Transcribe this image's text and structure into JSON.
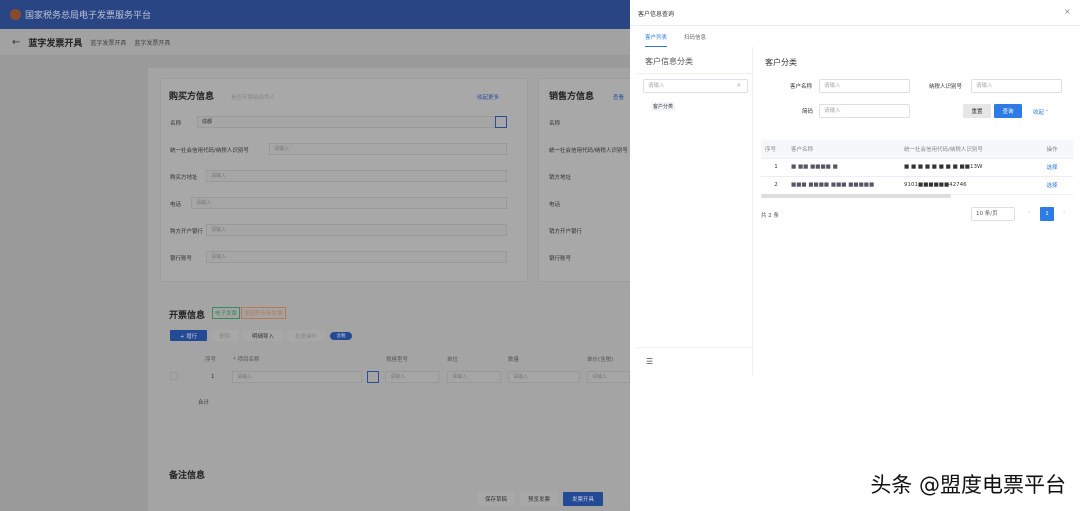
{
  "header": {
    "title": "国家税务总局电子发票服务平台"
  },
  "breadcrumb": {
    "page_title": "蓝字发票开具",
    "crumbs": [
      "蓝字发票开具",
      "蓝字发票开具"
    ]
  },
  "buyer": {
    "title": "购买方信息",
    "natural_person": "是否开票给自然人",
    "collapse": "收起更多",
    "fields": [
      {
        "label": "名称",
        "value": "成都"
      },
      {
        "label": "统一社会信用代码/纳税人识别号",
        "value": "请输入"
      },
      {
        "label": "购买方地址",
        "value": "请输入"
      },
      {
        "label": "电话",
        "value": "请输入"
      },
      {
        "label": "购方开户银行",
        "value": "请输入"
      },
      {
        "label": "银行账号",
        "value": "请输入"
      }
    ]
  },
  "seller": {
    "title": "销售方信息",
    "more": "查看",
    "fields": [
      "名称",
      "统一社会信用代码/纳税人识别号",
      "销方地址",
      "电话",
      "销方开户银行",
      "银行账号"
    ]
  },
  "invoice": {
    "title": "开票信息",
    "tag_green": "电子发票",
    "tag_orange": "增值税专用发票",
    "buttons": [
      "+ 增行",
      "删除",
      "明细导入",
      "批量操作",
      "含税"
    ],
    "columns": [
      "序号",
      "* 项目名称",
      "规格型号",
      "单位",
      "数量",
      "单价(含税)"
    ],
    "row_index": "1",
    "placeholder": "请输入",
    "total": "合计"
  },
  "remarks": {
    "title": "备注信息"
  },
  "footer": {
    "buttons": [
      "保存草稿",
      "预览发票",
      "发票开具"
    ]
  },
  "drawer": {
    "title": "客户信息查询",
    "close": "×",
    "tabs": [
      "客户列表",
      "扫码信息"
    ],
    "category_title": "客户信息分类",
    "search_placeholder": "请输入",
    "tree_item": "客户分类",
    "main_title": "客户分类",
    "form": {
      "name_label": "客户名称",
      "taxid_label": "纳税人识别号",
      "abbr_label": "简码",
      "placeholder": "请输入",
      "reset": "重置",
      "query": "查询",
      "collapse": "收起"
    },
    "table": {
      "columns": [
        "序号",
        "客户名称",
        "统一社会信用代码/纳税人识别号",
        "操作"
      ],
      "rows": [
        {
          "index": "1",
          "name": "■ ■■ ■■■■ ■",
          "taxid": "■ ■ ■ ■ ■ ■ ■ ■ ■■13W",
          "action": "选择"
        },
        {
          "index": "2",
          "name": "■■■ ■■■■ ■■■ ■■■■■",
          "taxid": "9101■■■■■■42746",
          "action": "选择"
        }
      ]
    },
    "pagination": {
      "total": "共 2 条",
      "page_size": "10 条/页",
      "current": "1"
    }
  },
  "watermark": "头条 @盟度电票平台"
}
